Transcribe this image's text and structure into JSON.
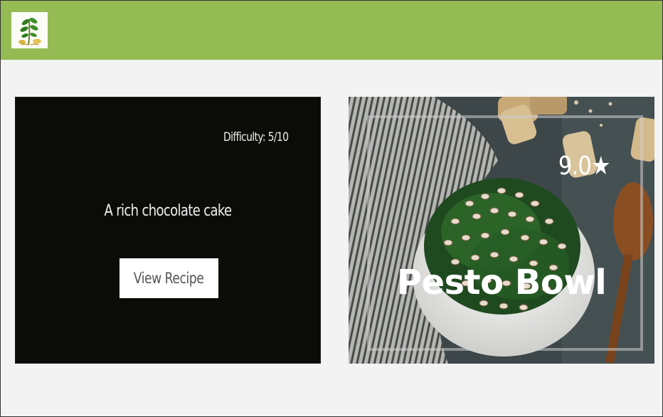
{
  "colors": {
    "navbar": "#95bb55",
    "page_background": "#f3f3f3",
    "card_background": "#0b0c07",
    "button_background": "#ffffff",
    "button_text": "#555555"
  },
  "navbar": {
    "logo_icon": "herb-sprig-logo-icon"
  },
  "recipe_card": {
    "difficulty": "Difficulty: 5/10",
    "description": "A rich chocolate cake",
    "button_label": "View Recipe"
  },
  "featured_card": {
    "image_icon": "pesto-bowl-photo",
    "rating": "9.0★",
    "title": "Pesto Bowl"
  }
}
